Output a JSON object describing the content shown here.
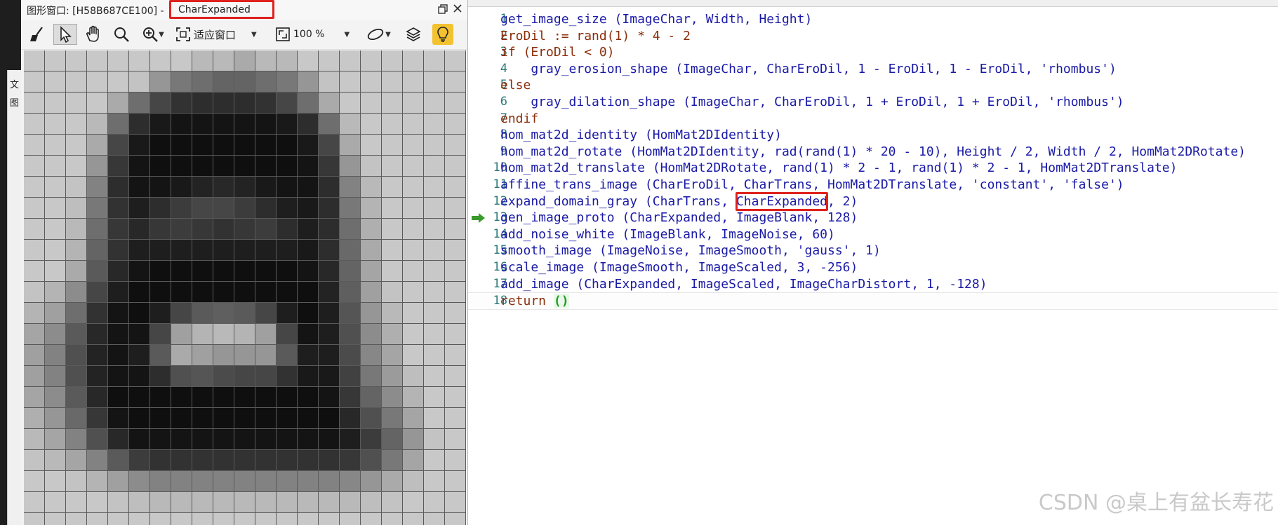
{
  "left_strip": {
    "tab1": "文",
    "tab2": "图"
  },
  "graphics_window": {
    "title_prefix": "图形窗口: [H58B687CE100]",
    "title_dash": " - ",
    "title_object": "CharExpanded",
    "restore_icon": "restore-window-icon",
    "close_icon": "close-icon",
    "toolbar": {
      "fit_label": "适应窗口",
      "zoom_label": "100 %"
    },
    "pixel_rows": [
      [
        200,
        200,
        200,
        200,
        200,
        200,
        200,
        200,
        185,
        185,
        170,
        185,
        185,
        200,
        200,
        200,
        200,
        200,
        200,
        200,
        200
      ],
      [
        200,
        200,
        200,
        200,
        200,
        195,
        150,
        120,
        110,
        100,
        100,
        110,
        120,
        150,
        195,
        200,
        200,
        200,
        200,
        200,
        200
      ],
      [
        200,
        200,
        200,
        200,
        170,
        110,
        70,
        50,
        45,
        45,
        45,
        50,
        70,
        110,
        170,
        200,
        200,
        200,
        200,
        200,
        200
      ],
      [
        200,
        200,
        200,
        185,
        110,
        45,
        25,
        20,
        20,
        20,
        20,
        20,
        25,
        45,
        110,
        185,
        200,
        200,
        200,
        200,
        200
      ],
      [
        200,
        200,
        200,
        170,
        70,
        25,
        15,
        15,
        15,
        15,
        15,
        15,
        15,
        25,
        70,
        170,
        200,
        200,
        200,
        200,
        200
      ],
      [
        200,
        200,
        200,
        150,
        55,
        20,
        15,
        15,
        15,
        15,
        15,
        15,
        15,
        20,
        55,
        150,
        195,
        200,
        200,
        200,
        200
      ],
      [
        200,
        200,
        195,
        130,
        45,
        20,
        20,
        25,
        35,
        40,
        35,
        25,
        20,
        20,
        45,
        130,
        185,
        200,
        200,
        200,
        200
      ],
      [
        200,
        200,
        190,
        120,
        50,
        30,
        45,
        60,
        70,
        70,
        60,
        45,
        30,
        25,
        45,
        120,
        180,
        200,
        200,
        200,
        200
      ],
      [
        200,
        200,
        185,
        110,
        55,
        40,
        55,
        60,
        55,
        50,
        55,
        60,
        45,
        30,
        45,
        110,
        175,
        200,
        200,
        200,
        200
      ],
      [
        200,
        200,
        180,
        100,
        50,
        30,
        30,
        30,
        30,
        30,
        30,
        30,
        30,
        25,
        45,
        105,
        170,
        200,
        200,
        200,
        200
      ],
      [
        200,
        200,
        170,
        90,
        40,
        20,
        15,
        15,
        15,
        15,
        15,
        15,
        15,
        20,
        40,
        100,
        165,
        200,
        200,
        200,
        200
      ],
      [
        195,
        180,
        140,
        70,
        30,
        15,
        15,
        15,
        15,
        15,
        15,
        15,
        15,
        15,
        35,
        95,
        160,
        195,
        200,
        200,
        200
      ],
      [
        180,
        160,
        110,
        50,
        20,
        15,
        30,
        70,
        90,
        95,
        90,
        70,
        30,
        15,
        30,
        85,
        150,
        185,
        200,
        200,
        200
      ],
      [
        165,
        140,
        90,
        40,
        20,
        20,
        70,
        160,
        180,
        185,
        180,
        160,
        70,
        20,
        30,
        80,
        140,
        175,
        200,
        200,
        200
      ],
      [
        160,
        130,
        80,
        35,
        20,
        30,
        90,
        170,
        160,
        150,
        150,
        150,
        90,
        30,
        30,
        75,
        135,
        165,
        200,
        200,
        200
      ],
      [
        160,
        130,
        80,
        35,
        20,
        20,
        45,
        80,
        85,
        75,
        70,
        70,
        50,
        25,
        25,
        65,
        120,
        155,
        190,
        200,
        200
      ],
      [
        165,
        140,
        90,
        40,
        15,
        15,
        15,
        15,
        15,
        15,
        15,
        15,
        15,
        15,
        20,
        55,
        100,
        140,
        180,
        200,
        200
      ],
      [
        175,
        150,
        105,
        55,
        20,
        15,
        15,
        15,
        15,
        15,
        15,
        15,
        15,
        15,
        15,
        40,
        80,
        120,
        165,
        200,
        200
      ],
      [
        185,
        165,
        130,
        80,
        40,
        20,
        20,
        20,
        20,
        20,
        20,
        20,
        20,
        20,
        20,
        30,
        60,
        100,
        150,
        195,
        200
      ],
      [
        195,
        185,
        165,
        130,
        90,
        60,
        50,
        50,
        50,
        50,
        50,
        50,
        50,
        50,
        50,
        55,
        80,
        120,
        165,
        200,
        200
      ],
      [
        200,
        200,
        195,
        180,
        160,
        140,
        130,
        130,
        130,
        130,
        130,
        130,
        130,
        130,
        130,
        135,
        150,
        170,
        190,
        200,
        200
      ],
      [
        200,
        200,
        200,
        200,
        195,
        190,
        185,
        185,
        185,
        185,
        185,
        185,
        185,
        185,
        185,
        185,
        190,
        195,
        200,
        200,
        200
      ],
      [
        200,
        200,
        200,
        200,
        200,
        200,
        200,
        200,
        200,
        200,
        200,
        200,
        200,
        200,
        200,
        200,
        200,
        200,
        200,
        200,
        200
      ]
    ]
  },
  "editor": {
    "lines": [
      {
        "n": "1",
        "html": "get_image_size (ImageChar, Width, Height)"
      },
      {
        "n": "2",
        "kw": "EroDil := rand(1) * 4 - 2"
      },
      {
        "n": "3",
        "kw": "if (EroDil < 0)"
      },
      {
        "n": "4",
        "html": "    gray_erosion_shape (ImageChar, CharEroDil, 1 - EroDil, 1 - EroDil, 'rhombus')"
      },
      {
        "n": "5",
        "kw": "else"
      },
      {
        "n": "6",
        "html": "    gray_dilation_shape (ImageChar, CharEroDil, 1 + EroDil, 1 + EroDil, 'rhombus')"
      },
      {
        "n": "7",
        "kw": "endif"
      },
      {
        "n": "8",
        "html": "hom_mat2d_identity (HomMat2DIdentity)"
      },
      {
        "n": "9",
        "html": "hom_mat2d_rotate (HomMat2DIdentity, rad(rand(1) * 20 - 10), Height / 2, Width / 2, HomMat2DRotate)"
      },
      {
        "n": "10",
        "html": "hom_mat2d_translate (HomMat2DRotate, rand(1) * 2 - 1, rand(1) * 2 - 1, HomMat2DTranslate)"
      },
      {
        "n": "11",
        "html": "affine_trans_image (CharEroDil, CharTrans, HomMat2DTranslate, 'constant', 'false')"
      },
      {
        "n": "12",
        "html": "expand_domain_gray (CharTrans, CharExpanded, 2)"
      },
      {
        "n": "13",
        "html": "gen_image_proto (CharExpanded, ImageBlank, 128)"
      },
      {
        "n": "14",
        "html": "add_noise_white (ImageBlank, ImageNoise, 60)"
      },
      {
        "n": "15",
        "html": "smooth_image (ImageNoise, ImageSmooth, 'gauss', 1)"
      },
      {
        "n": "16",
        "html": "scale_image (ImageSmooth, ImageScaled, 3, -256)"
      },
      {
        "n": "17",
        "html": "add_image (CharExpanded, ImageScaled, ImageCharDistort, 1, -128)"
      },
      {
        "n": "18",
        "kw": "return ",
        "paren": "()"
      }
    ],
    "current_line": "13",
    "highlight_word": "CharExpanded",
    "watermark": "CSDN @桌上有盆长寿花"
  }
}
